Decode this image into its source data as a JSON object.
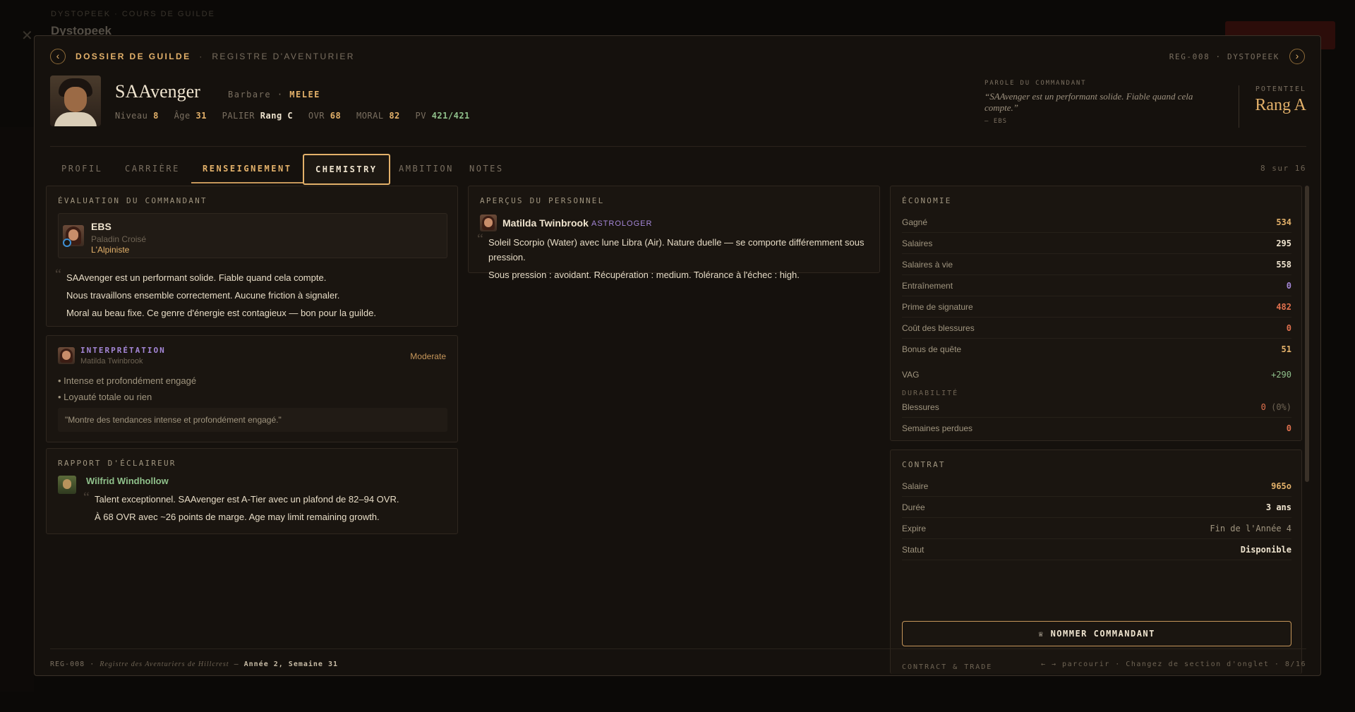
{
  "backdrop": {
    "crumb": "DYSTOPEEK · COURS DE GUILDE",
    "title": "Dystopeek"
  },
  "breadcrumb": {
    "section": "DOSSIER DE GUILDE",
    "separator": "·",
    "subsection": "REGISTRE D'AVENTURIER",
    "record": "REG-008 · DYSTOPEEK"
  },
  "hero": {
    "name": "SAAvenger",
    "class": "Barbare",
    "dot": "·",
    "style": "MELEE",
    "stats": {
      "niveau_label": "Niveau",
      "niveau": "8",
      "age_label": "Âge",
      "age": "31",
      "palier_label": "PALIER",
      "palier": "Rang C",
      "ovr_label": "OVR",
      "ovr": "68",
      "moral_label": "MORAL",
      "moral": "82",
      "pv_label": "PV",
      "pv": "421/421"
    },
    "commander_word": {
      "label": "PAROLE DU COMMANDANT",
      "quote": "“SAAvenger est un performant solide. Fiable quand cela compte.”",
      "by": "— EBS"
    },
    "potential": {
      "label": "POTENTIEL",
      "value": "Rang A"
    }
  },
  "tabs": [
    {
      "label": "PROFIL"
    },
    {
      "label": "CARRIÈRE"
    },
    {
      "label": "RENSEIGNEMENT"
    },
    {
      "label": "CHEMISTRY"
    },
    {
      "label": "AMBITION"
    },
    {
      "label": "NOTES"
    }
  ],
  "tab_counter": "8 sur 16",
  "evaluation": {
    "title": "ÉVALUATION DU COMMANDANT",
    "commander": {
      "name": "EBS",
      "role": "Paladin Croisé",
      "title": "L'Alpiniste"
    },
    "lines": [
      "SAAvenger est un performant solide. Fiable quand cela compte.",
      "Nous travaillons ensemble correctement. Aucune friction à signaler.",
      "Moral au beau fixe. Ce genre d'énergie est contagieux — bon pour la guilde."
    ]
  },
  "interpretation": {
    "title": "INTERPRÉTATION",
    "by": "Matilda Twinbrook",
    "level": "Moderate",
    "bullets": [
      "Intense et profondément engagé",
      "Loyauté totale ou rien"
    ],
    "quote": "\"Montre des tendances intense et profondément engagé.\""
  },
  "scout": {
    "title": "RAPPORT D'ÉCLAIREUR",
    "name": "Wilfrid Windhollow",
    "lines": [
      "Talent exceptionnel. SAAvenger est A-Tier avec un plafond de 82–94 OVR.",
      "À 68 OVR avec ~26 points de marge. Age may limit remaining growth."
    ]
  },
  "staff": {
    "title": "APERÇUS DU PERSONNEL",
    "name": "Matilda Twinbrook",
    "role": "ASTROLOGER",
    "lines": [
      "Soleil Scorpio (Water) avec lune Libra (Air). Nature duelle — se comporte différemment sous",
      "pression.",
      "Sous pression : avoidant. Récupération : medium. Tolérance à l'échec : high."
    ]
  },
  "economy": {
    "title": "ÉCONOMIE",
    "rows": [
      {
        "label": "Gagné",
        "value": "534",
        "color": "#e3b16a"
      },
      {
        "label": "Salaires",
        "value": "295",
        "color": "#efe4cf"
      },
      {
        "label": "Salaires à vie",
        "value": "558",
        "color": "#efe4cf"
      },
      {
        "label": "Entraînement",
        "value": "0",
        "color": "#a587d8"
      },
      {
        "label": "Prime de signature",
        "value": "482",
        "color": "#e0714e"
      },
      {
        "label": "Coût des blessures",
        "value": "0",
        "color": "#e0714e"
      },
      {
        "label": "Bonus de quête",
        "value": "51",
        "color": "#e3b16a"
      }
    ],
    "vag_label": "VAG",
    "vag_value": "+290",
    "durability_label": "DURABILITÉ",
    "injuries_label": "Blessures",
    "injuries_value": "0",
    "injuries_pct": "(0%)",
    "weeks_label": "Semaines perdues",
    "weeks_value": "0"
  },
  "contract": {
    "title": "CONTRAT",
    "rows": [
      {
        "label": "Salaire",
        "value": "965o",
        "color": "#e3b16a"
      },
      {
        "label": "Durée",
        "value": "3 ans",
        "color": "#efe4cf"
      },
      {
        "label": "Expire",
        "value": "Fin de l'Année 4",
        "color": "#a0957f"
      },
      {
        "label": "Statut",
        "value": "Disponible",
        "color": "#efe4cf"
      }
    ],
    "button": "NOMMER COMMANDANT",
    "trade_label": "CONTRACT & TRADE"
  },
  "footer": {
    "code": "REG-008",
    "dot": "·",
    "registry": "Registre des Aventuriers de Hillcrest",
    "dash": "—",
    "date": "Année 2, Semaine 31",
    "hint": "← → parcourir · Changez de section d'onglet · 8/16"
  }
}
